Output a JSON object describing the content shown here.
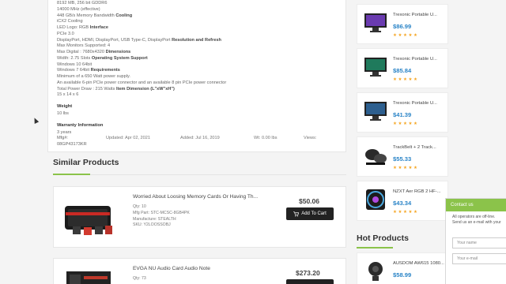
{
  "specs": {
    "lines": [
      {
        "text": "8192 MB, 256 bit GDDR6"
      },
      {
        "text": "14000 MHz (effective)"
      },
      {
        "text": "448 GB/s Memory Bandwidth ",
        "bold": "Cooling"
      },
      {
        "text": "iCX2 Cooling"
      },
      {
        "text": "LED Logo: RGB ",
        "bold": "Interface"
      },
      {
        "text": "PCIe 3.0"
      },
      {
        "text": "DisplayPort, HDMI, DisplayPort, USB Type-C, DisplayPort ",
        "bold": "Resolution and Refresh"
      },
      {
        "text": "Max Monitors Supported: 4"
      },
      {
        "text": "Max Digital : 7680x4320 ",
        "bold": "Dimensions"
      },
      {
        "text": "Width: 2.75 Slots ",
        "bold": "Operating System Support"
      },
      {
        "text": "Windows 10 64bit"
      },
      {
        "text": "Windows 7 64bit ",
        "bold": "Requirements"
      },
      {
        "text": "Minimum of a 650 Watt power supply."
      },
      {
        "text": "An available 6-pin PCIe power connector and an available 8 pin PCIe power connector"
      },
      {
        "text": "Total Power Draw : 215 Watts ",
        "bold": "Item Dimension (L\"xW\"xH\")"
      },
      {
        "text": "15 x 14 x 6"
      }
    ],
    "weight_label": "Weight",
    "weight_value": "10 lbs",
    "warranty_label": "Warranty Information",
    "warranty_value": "3 years",
    "mfg_label": "Mfg#:",
    "mfg_value": "08GP43173KR",
    "updated": "Updated: Apr 02, 2021",
    "added": "Added: Jul 16, 2019",
    "wt": "Wt: 0.00 lbs",
    "views": "Views:"
  },
  "similar": {
    "title": "Similar Products",
    "items": [
      {
        "name": "Worried About Loosing Memory Cards Or Having Th...",
        "qty": "Qty: 10",
        "mfg": "Mfg Part: STC-MCSC-8GB4PK",
        "manufacturer": "Manufacture: STEALTH",
        "sku": "SKU: Y2LOOSSOBJ",
        "price": "$50.06",
        "button": "Add To Cart"
      },
      {
        "name": "EVGA NU Audio Card Audio Note",
        "qty": "Qty: 73",
        "price": "$273.20"
      }
    ]
  },
  "sidebar": {
    "items": [
      {
        "name": "Trexonic Portable U...",
        "price": "$86.99",
        "stars": "★★★★★"
      },
      {
        "name": "Trexonic Portable U...",
        "price": "$85.84",
        "stars": "★★★★★"
      },
      {
        "name": "Trexonic Portable U...",
        "price": "$41.39",
        "stars": "★★★★★"
      },
      {
        "name": "TrackBelt + 2 Track...",
        "price": "$55.33",
        "stars": "★★★★★"
      },
      {
        "name": "NZXT Aer RGB 2 HF-...",
        "price": "$43.34",
        "stars": "★★★★★"
      }
    ],
    "hot_title": "Hot Products",
    "hot_items": [
      {
        "name": "AUSDOM AW615 1080...",
        "price": "$58.99"
      }
    ]
  },
  "contact": {
    "title": "Contact us",
    "line1": "All operators are off-line.",
    "line2": "Send us an e-mail with your",
    "name_placeholder": "Your name",
    "email_placeholder": "Your e-mail"
  },
  "colors": {
    "accent": "#8bc34a",
    "price": "#2a84c7",
    "star": "#f5a623"
  }
}
